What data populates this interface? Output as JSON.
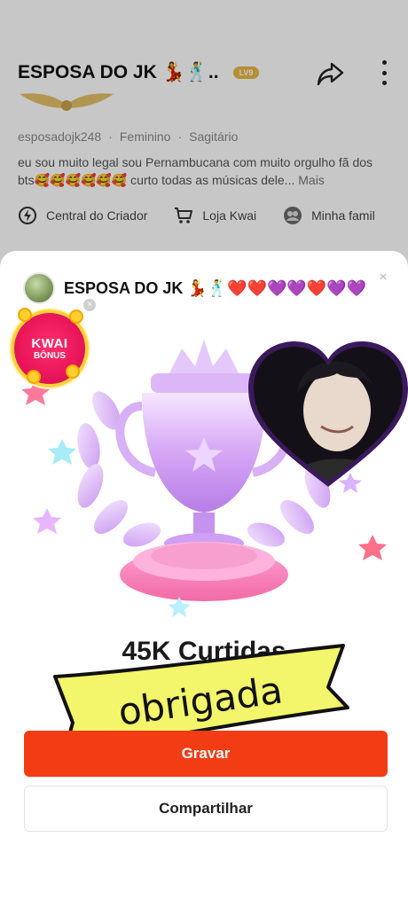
{
  "profile": {
    "name": "ESPOSA DO JK 💃🕺..",
    "level": "LV9",
    "handle": "esposadojk248",
    "gender": "Feminino",
    "sign": "Sagitário",
    "separator": "·",
    "bio": "eu sou muito legal sou Pernambucana com muito orgulho fã dos bts🥰🥰🥰🥰🥰🥰 curto todas as músicas dele...",
    "bio_more": "Mais"
  },
  "quick_links": [
    {
      "label": "Central do Criador",
      "icon": "bolt-circle-icon"
    },
    {
      "label": "Loja Kwai",
      "icon": "cart-icon"
    },
    {
      "label": "Minha famil",
      "icon": "family-icon"
    }
  ],
  "sheet": {
    "title": "ESPOSA DO JK 💃🕺❤️❤️💜💜❤️💜💜",
    "close": "×",
    "bonus_line1": "KWAI",
    "bonus_line2": "BÔNUS",
    "bonus_close": "×",
    "likes": "45K Curtidas",
    "ribbon_text": "obrigada",
    "record_button": "Gravar",
    "share_button": "Compartilhar"
  },
  "colors": {
    "accent": "#f23d14",
    "badge": "#e8155a",
    "ribbon": "#f3f56a"
  }
}
